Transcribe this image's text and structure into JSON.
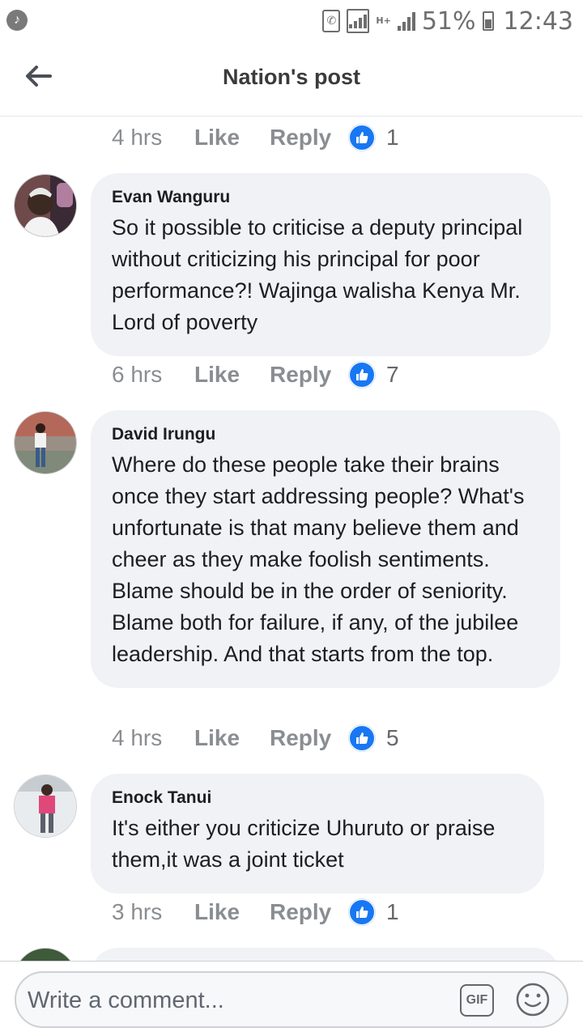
{
  "status_bar": {
    "battery": "51%",
    "time": "12:43",
    "network": "H+",
    "music_icon": "music-note-icon",
    "color": "#6e6e6e"
  },
  "header": {
    "title": "Nation's post",
    "back_icon": "arrow-left-icon"
  },
  "comments": [
    {
      "name": "",
      "text": "",
      "time": "4 hrs",
      "like": "Like",
      "reply": "Reply",
      "reactions": "1"
    },
    {
      "name": "Evan Wanguru",
      "text": "So it possible to criticise a deputy principal without criticizing his principal for poor performance?! Wajinga walisha Kenya Mr. Lord of poverty",
      "time": "6 hrs",
      "like": "Like",
      "reply": "Reply",
      "reactions": "7"
    },
    {
      "name": "David Irungu",
      "text": "Where do these people take their brains once they start addressing people? What's unfortunate is that many believe them and cheer as they make foolish sentiments. Blame should be in the order of seniority. Blame both for failure, if any, of the jubilee leadership. And that starts from the top.",
      "time": "4 hrs",
      "like": "Like",
      "reply": "Reply",
      "reactions": "5"
    },
    {
      "name": "Enock Tanui",
      "text": "It's either you criticize Uhuruto or praise them,it was a joint ticket",
      "time": "3 hrs",
      "like": "Like",
      "reply": "Reply",
      "reactions": "1"
    }
  ],
  "composer": {
    "placeholder": "Write a comment...",
    "gif_label": "GIF",
    "emoji_icon": "smiley-face-icon"
  },
  "colors": {
    "accent": "#1877f2",
    "bubble": "#f0f2f5",
    "meta_text": "#8a8d91"
  }
}
